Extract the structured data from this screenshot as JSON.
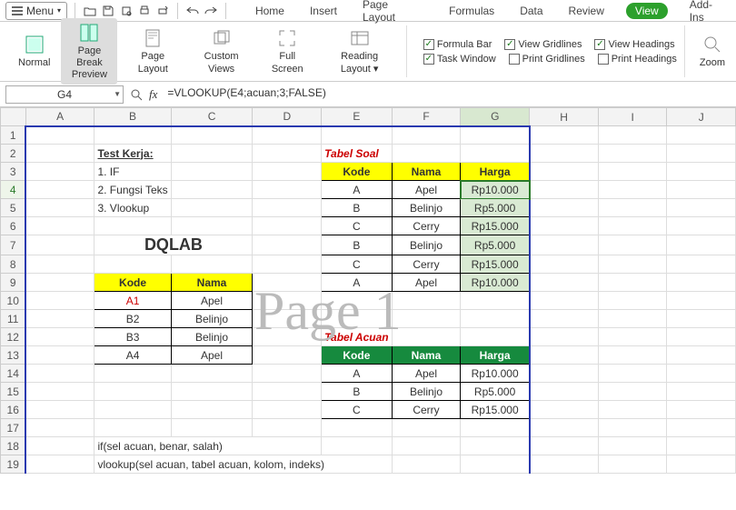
{
  "topbar": {
    "menu": "Menu"
  },
  "tabs": [
    "Home",
    "Insert",
    "Page Layout",
    "Formulas",
    "Data",
    "Review",
    "View",
    "Add-Ins"
  ],
  "active_tab": "View",
  "ribbon": {
    "views": [
      {
        "label": "Normal",
        "active": false
      },
      {
        "label": "Page Break\nPreview",
        "active": true
      },
      {
        "label": "Page Layout",
        "active": false
      },
      {
        "label": "Custom Views",
        "active": false
      },
      {
        "label": "Full Screen",
        "active": false
      },
      {
        "label": "Reading Layout ▾",
        "active": false
      }
    ],
    "checks_left": [
      {
        "label": "Formula Bar",
        "checked": true
      },
      {
        "label": "Task Window",
        "checked": true
      }
    ],
    "checks_mid": [
      {
        "label": "View Gridlines",
        "checked": true
      },
      {
        "label": "Print Gridlines",
        "checked": false
      }
    ],
    "checks_right": [
      {
        "label": "View Headings",
        "checked": true
      },
      {
        "label": "Print Headings",
        "checked": false
      }
    ],
    "zoom": "Zoom"
  },
  "namebox": "G4",
  "fx": "fx",
  "formula": "=VLOOKUP(E4;acuan;3;FALSE)",
  "cols": [
    "A",
    "B",
    "C",
    "D",
    "E",
    "F",
    "G",
    "H",
    "I",
    "J"
  ],
  "rows_count": 19,
  "watermark": "Page 1",
  "sheet": {
    "B2": "Test Kerja:",
    "B3": "1. IF",
    "B4": "2. Fungsi Teks",
    "B5": "3. Vlookup",
    "BC7": "DQLAB",
    "B9": "Kode",
    "C9": "Nama",
    "B10": "A1",
    "C10": "Apel",
    "B11": "B2",
    "C11": "Belinjo",
    "B12": "B3",
    "C12": "Belinjo",
    "B13": "A4",
    "C13": "Apel",
    "E2": "Tabel Soal",
    "E3": "Kode",
    "F3": "Nama",
    "G3": "Harga",
    "E4": "A",
    "F4": "Apel",
    "G4": "Rp10.000",
    "E5": "B",
    "F5": "Belinjo",
    "G5": "Rp5.000",
    "E6": "C",
    "F6": "Cerry",
    "G6": "Rp15.000",
    "E7": "B",
    "F7": "Belinjo",
    "G7": "Rp5.000",
    "E8": "C",
    "F8": "Cerry",
    "G8": "Rp15.000",
    "E9": "A",
    "F9": "Apel",
    "G9": "Rp10.000",
    "E12": "Tabel Acuan",
    "E13": "Kode",
    "F13": "Nama",
    "G13": "Harga",
    "E14": "A",
    "F14": "Apel",
    "G14": "Rp10.000",
    "E15": "B",
    "F15": "Belinjo",
    "G15": "Rp5.000",
    "E16": "C",
    "F16": "Cerry",
    "G16": "Rp15.000",
    "B18": "if(sel acuan, benar, salah)",
    "B19": "vlookup(sel acuan, tabel acuan, kolom, indeks)"
  }
}
